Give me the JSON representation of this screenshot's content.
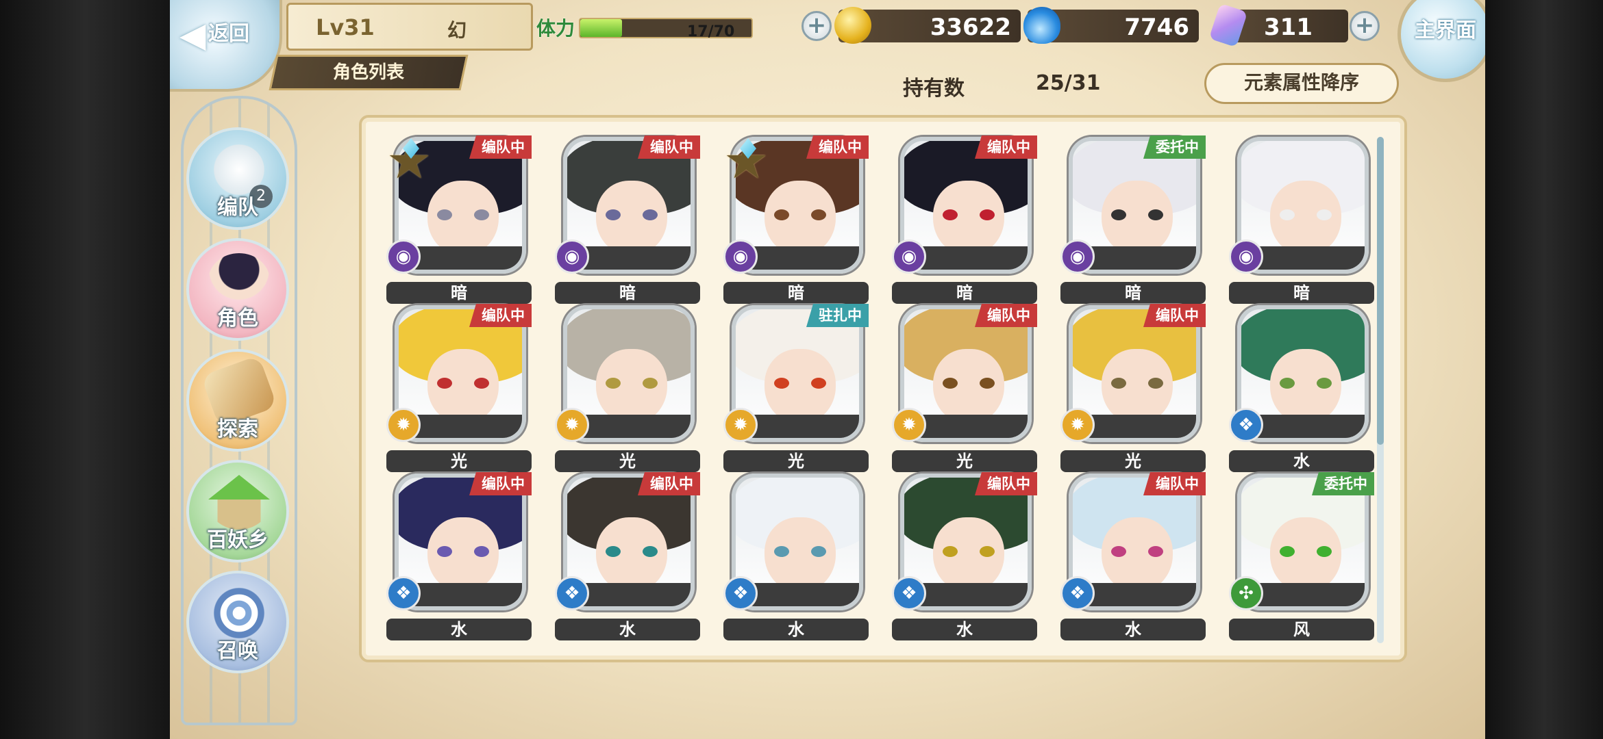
{
  "header": {
    "back_label": "返回",
    "level": "Lv31",
    "player_name": "幻",
    "page_title": "角色列表",
    "stamina_label": "体力",
    "stamina_value": "17/70",
    "stamina_fraction": 0.243,
    "gold": "33622",
    "soul": "7746",
    "crystal": "311",
    "home_label": "主界面"
  },
  "toolbar": {
    "owned_label": "持有数",
    "owned_value": "25/31",
    "sort_label": "元素属性降序"
  },
  "nav": [
    {
      "label": "编队",
      "badge": "2"
    },
    {
      "label": "角色"
    },
    {
      "label": "探索"
    },
    {
      "label": "百妖乡"
    },
    {
      "label": "召唤"
    }
  ],
  "colors": {
    "tag_team": "#c83a3a",
    "tag_mission": "#4aa04a",
    "tag_station": "#3aa0a8",
    "elem_dark": "#6a3fa0",
    "elem_light": "#e6a82a",
    "elem_water": "#2e7cc8",
    "elem_wind": "#3e9a3a"
  },
  "characters": [
    {
      "element": "暗",
      "status": "编队中",
      "starred": true
    },
    {
      "element": "暗",
      "status": "编队中",
      "starred": false
    },
    {
      "element": "暗",
      "status": "编队中",
      "starred": true
    },
    {
      "element": "暗",
      "status": "编队中",
      "starred": false
    },
    {
      "element": "暗",
      "status": "委托中",
      "starred": false
    },
    {
      "element": "暗",
      "status": "",
      "starred": false
    },
    {
      "element": "光",
      "status": "编队中",
      "starred": false
    },
    {
      "element": "光",
      "status": "",
      "starred": false
    },
    {
      "element": "光",
      "status": "驻扎中",
      "starred": false
    },
    {
      "element": "光",
      "status": "编队中",
      "starred": false
    },
    {
      "element": "光",
      "status": "编队中",
      "starred": false
    },
    {
      "element": "水",
      "status": "",
      "starred": false
    },
    {
      "element": "水",
      "status": "编队中",
      "starred": false
    },
    {
      "element": "水",
      "status": "编队中",
      "starred": false
    },
    {
      "element": "水",
      "status": "",
      "starred": false
    },
    {
      "element": "水",
      "status": "编队中",
      "starred": false
    },
    {
      "element": "水",
      "status": "编队中",
      "starred": false
    },
    {
      "element": "风",
      "status": "委托中",
      "starred": false
    }
  ]
}
